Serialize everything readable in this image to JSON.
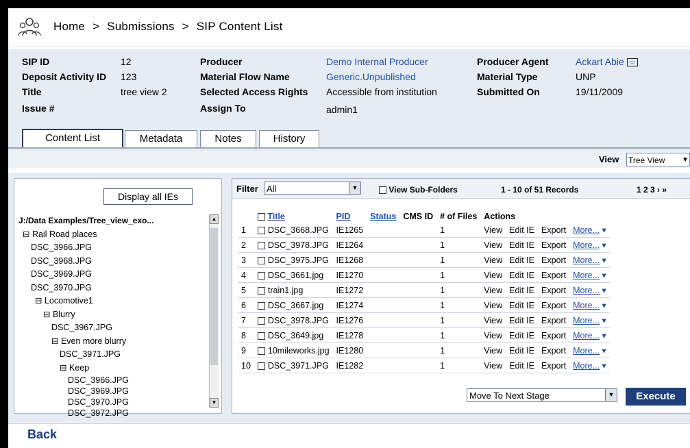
{
  "breadcrumb": [
    "Home",
    ">",
    "Submissions",
    ">",
    "SIP Content List"
  ],
  "info": {
    "sip_id_label": "SIP ID",
    "sip_id": "12",
    "deposit_label": "Deposit Activity ID",
    "deposit": "123",
    "title_label": "Title",
    "title": "tree view 2",
    "issue_label": "Issue #",
    "producer_label": "Producer",
    "producer": "Demo Internal Producer",
    "mfn_label": "Material Flow Name",
    "mfn": "Generic.Unpublished",
    "rights_label": "Selected Access Rights",
    "rights": "Accessible from institution",
    "assign_label": "Assign To",
    "assign": "admin1",
    "agent_label": "Producer Agent",
    "agent": "Ackart Abie",
    "mtype_label": "Material Type",
    "mtype": "UNP",
    "submitted_label": "Submitted On",
    "submitted": "19/11/2009"
  },
  "tabs": [
    "Content List",
    "Metadata",
    "Notes",
    "History"
  ],
  "view": {
    "label": "View",
    "value": "Tree View"
  },
  "left_panel": {
    "display_button": "Display all IEs",
    "tree": [
      "J:/Data Examples/Tree_view_exo...",
      "⊟ Rail Road places",
      "DSC_3966.JPG",
      "DSC_3968.JPG",
      "DSC_3969.JPG",
      "DSC_3970.JPG",
      "⊟ Locomotive1",
      "⊟ Blurry",
      "DSC_3967.JPG",
      "⊟ Even more blurry",
      "DSC_3971.JPG",
      "⊟ Keep",
      "DSC_3966.JPG",
      "DSC_3969.JPG",
      "DSC_3970.JPG",
      "DSC_3972.JPG"
    ]
  },
  "right_panel": {
    "filter_label": "Filter",
    "filter_value": "All",
    "view_subfolders": "View Sub-Folders",
    "records": "1 - 10 of 51 Records",
    "pages": "1 2 3 › »",
    "columns": [
      "Title",
      "PID",
      "Status",
      "CMS ID",
      "# of Files",
      "Actions"
    ],
    "rows": [
      {
        "n": "1",
        "title": "DSC_3668.JPG",
        "pid": "IE1265",
        "files": "1"
      },
      {
        "n": "2",
        "title": "DSC_3978.JPG",
        "pid": "IE1264",
        "files": "1"
      },
      {
        "n": "3",
        "title": "DSC_3975.JPG",
        "pid": "IE1268",
        "files": "1"
      },
      {
        "n": "4",
        "title": "DSC_3661.jpg",
        "pid": "IE1270",
        "files": "1"
      },
      {
        "n": "5",
        "title": "train1.jpg",
        "pid": "IE1272",
        "files": "1"
      },
      {
        "n": "6",
        "title": "DSC_3667.jpg",
        "pid": "IE1274",
        "files": "1"
      },
      {
        "n": "7",
        "title": "DSC_3978.JPG",
        "pid": "IE1276",
        "files": "1"
      },
      {
        "n": "8",
        "title": "DSC_3649.jpg",
        "pid": "IE1278",
        "files": "1"
      },
      {
        "n": "9",
        "title": "10mileworks.jpg",
        "pid": "IE1280",
        "files": "1"
      },
      {
        "n": "10",
        "title": "DSC_3971.JPG",
        "pid": "IE1282",
        "files": "1"
      }
    ],
    "actions": {
      "view": "View",
      "edit": "Edit IE",
      "export": "Export",
      "more": "More..."
    },
    "stage_select": "Move To Next Stage",
    "execute": "Execute"
  },
  "back": "Back",
  "colors": {
    "accent": "#1f3f7c",
    "link": "#1f4fa8",
    "panel_bg": "#e6ecf3"
  }
}
